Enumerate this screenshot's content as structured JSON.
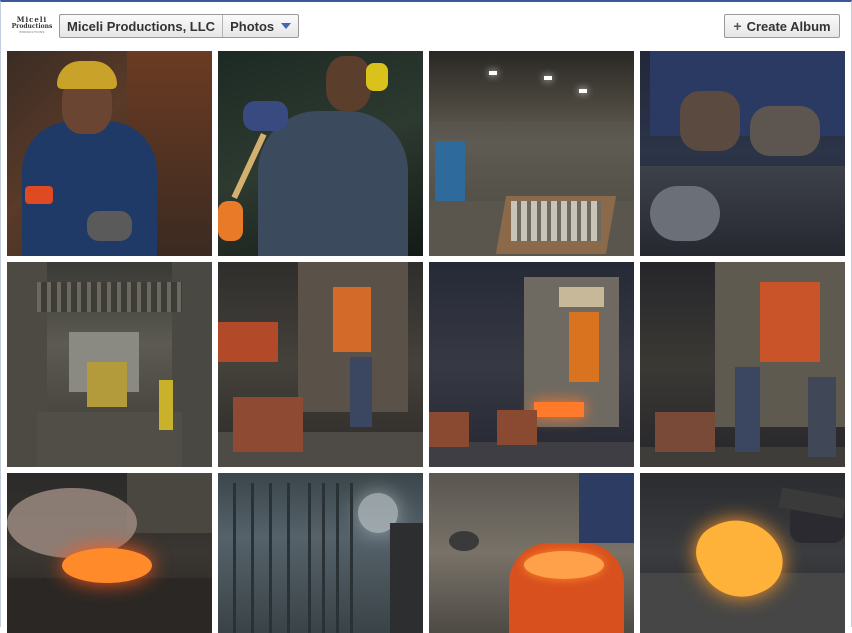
{
  "header": {
    "logo": {
      "line1": "Miceli",
      "line2": "Productions",
      "line3": "PRODUCTIONS"
    },
    "breadcrumb": {
      "page_name": "Miceli Productions, LLC",
      "section": "Photos"
    },
    "create_album_label": "Create Album",
    "icons": {
      "create": "plus-icon",
      "dropdown": "chevron-down-icon"
    }
  },
  "accent_color": "#3b5998",
  "photos": [
    {
      "subject": "worker-portrait"
    },
    {
      "subject": "worker-with-glasses"
    },
    {
      "subject": "factory-interior"
    },
    {
      "subject": "gloved-hands"
    },
    {
      "subject": "corridor-forklift"
    },
    {
      "subject": "forge-press"
    },
    {
      "subject": "4000-press"
    },
    {
      "subject": "press-with-workers"
    },
    {
      "subject": "forge-fire"
    },
    {
      "subject": "misty-factory"
    },
    {
      "subject": "molten-crucible"
    },
    {
      "subject": "glowing-metal"
    }
  ]
}
